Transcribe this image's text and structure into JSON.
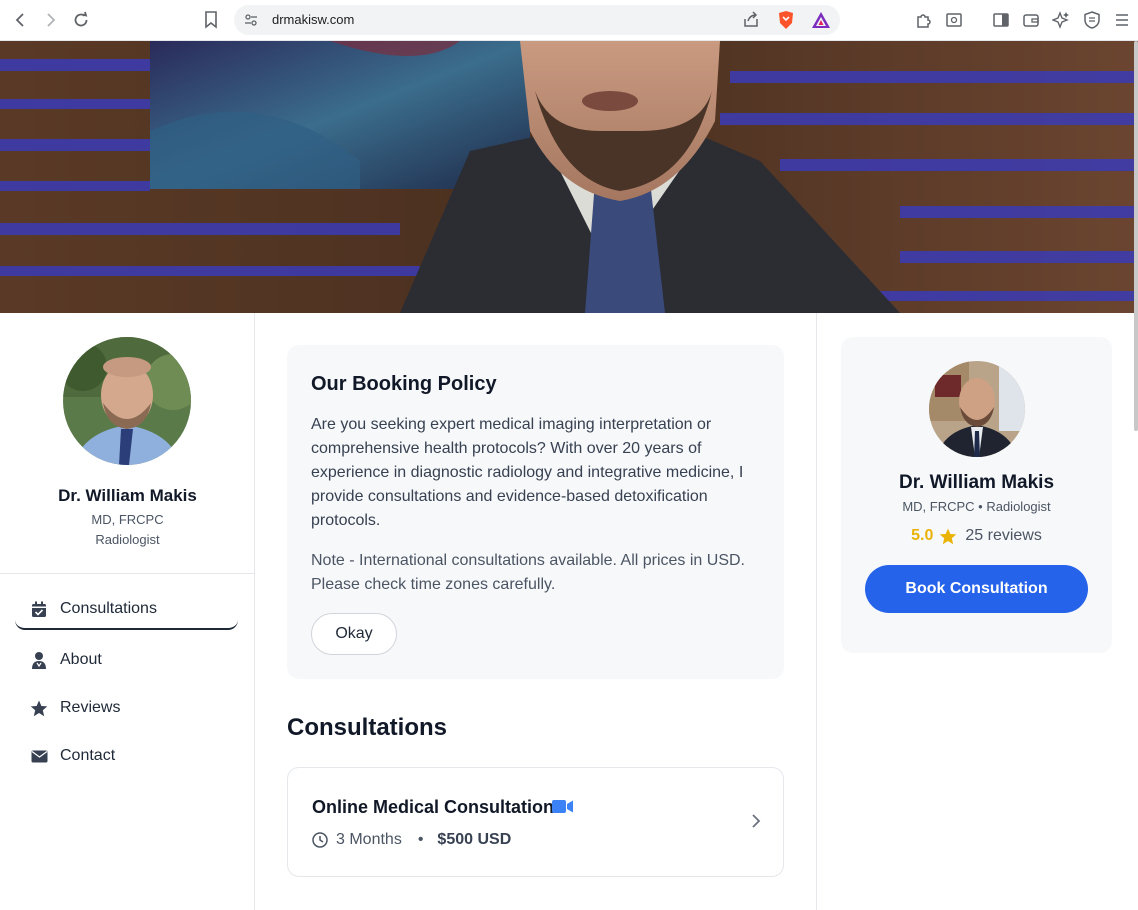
{
  "browser": {
    "url": "drmakisw.com",
    "icons": [
      "back-icon",
      "forward-icon",
      "reload-icon",
      "bookmark-icon",
      "site-settings-icon",
      "share-icon",
      "brave-shields-icon",
      "brave-rewards-icon",
      "extensions-icon",
      "reader-mode-icon",
      "sidebar-icon",
      "wallet-icon",
      "leo-ai-icon",
      "vpn-icon",
      "menu-icon"
    ]
  },
  "profile": {
    "name": "Dr. William Makis",
    "credentials": "MD, FRCPC",
    "specialty": "Radiologist",
    "credentials_line": "MD, FRCPC • Radiologist"
  },
  "sidebar": {
    "items": [
      {
        "label": "Consultations",
        "icon": "calendar-check-icon",
        "active": true
      },
      {
        "label": "About",
        "icon": "user-doctor-icon",
        "active": false
      },
      {
        "label": "Reviews",
        "icon": "star-icon",
        "active": false
      },
      {
        "label": "Contact",
        "icon": "envelope-icon",
        "active": false
      }
    ]
  },
  "policy": {
    "title": "Our Booking Policy",
    "body": "Are you seeking expert medical imaging interpretation or comprehensive health protocols? With over 20 years of experience in diagnostic radiology and integrative medicine, I provide consultations and evidence-based detoxification protocols.",
    "note": "Note - International consultations available. All prices in USD. Please check time zones carefully.",
    "button_label": "Okay"
  },
  "consultations": {
    "title": "Consultations",
    "items": [
      {
        "title": "Online Medical Consultation",
        "duration": "3 Months",
        "separator": "•",
        "price": "$500 USD",
        "icon": "video-icon"
      }
    ]
  },
  "booking_card": {
    "rating": "5.0",
    "reviews": "25 reviews",
    "button_label": "Book Consultation"
  },
  "colors": {
    "accent": "#2563eb",
    "star": "#eab308",
    "video_icon": "#3b82f6"
  }
}
